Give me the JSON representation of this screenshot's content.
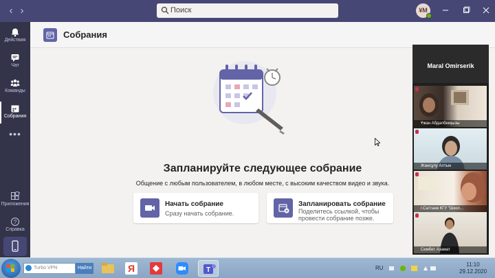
{
  "titlebar": {
    "search_placeholder": "Поиск",
    "avatar_initials": "¥M"
  },
  "rail": {
    "items": [
      {
        "label": "Действия",
        "icon": "bell-icon"
      },
      {
        "label": "Чат",
        "icon": "chat-icon"
      },
      {
        "label": "Команды",
        "icon": "teams-icon"
      },
      {
        "label": "Собрания",
        "icon": "calendar-icon",
        "active": true
      },
      {
        "label": "Приложения",
        "icon": "apps-icon"
      },
      {
        "label": "Справка",
        "icon": "help-icon"
      }
    ],
    "more_label": "•••"
  },
  "header": {
    "title": "Собрания"
  },
  "main": {
    "headline": "Запланируйте следующее собрание",
    "subtitle": "Общение с любым пользователем, в любом месте, с высоким качеством видео и звука.",
    "cards": [
      {
        "title": "Начать собрание",
        "desc_lines": [
          "Сразу начать собрание."
        ]
      },
      {
        "title": "Запланировать собрание",
        "desc_lines": [
          "Поделитесь ссылкой, чтобы",
          "провести собрание позже."
        ]
      }
    ]
  },
  "video_panel": {
    "presenter": "Maral Omirserik",
    "tiles": [
      {
        "name": "Ұжан Абдалбекқызы"
      },
      {
        "name": "Жансұлу Алтын"
      },
      {
        "name": "г.Саттаев КГУ \"Школ..."
      },
      {
        "name": "Сембет Азамат"
      }
    ]
  },
  "taskbar": {
    "vpn_placeholder": "Turbo VPN",
    "go_label": "Найти",
    "lang": "RU",
    "time": "11:10",
    "date": "29.12.2020"
  },
  "colors": {
    "teams_purple": "#6264a7",
    "titlebar": "#464775",
    "rail": "#33344a",
    "presence_green": "#6bb700"
  }
}
